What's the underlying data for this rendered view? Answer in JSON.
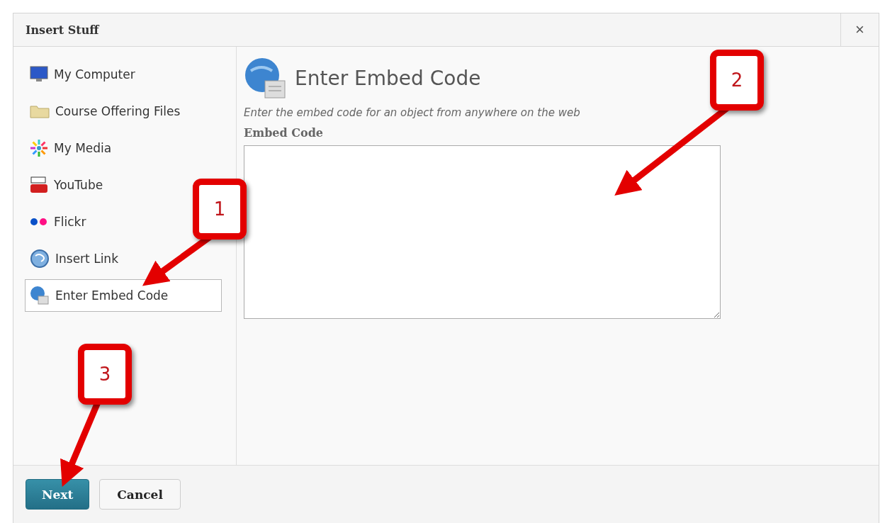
{
  "dialog": {
    "title": "Insert Stuff",
    "close": "×"
  },
  "sidebar": {
    "items": [
      {
        "label": "My Computer",
        "kind": "computer",
        "selected": false
      },
      {
        "label": "Course Offering Files",
        "kind": "folder",
        "selected": false
      },
      {
        "label": "My Media",
        "kind": "media",
        "selected": false
      },
      {
        "label": "YouTube",
        "kind": "youtube",
        "selected": false
      },
      {
        "label": "Flickr",
        "kind": "flickr",
        "selected": false
      },
      {
        "label": "Insert Link",
        "kind": "link",
        "selected": false
      },
      {
        "label": "Enter Embed Code",
        "kind": "embed",
        "selected": true
      }
    ]
  },
  "content": {
    "title": "Enter Embed Code",
    "description": "Enter the embed code for an object from anywhere on the web",
    "field_label": "Embed Code"
  },
  "footer": {
    "buttons": [
      {
        "label": "Next",
        "kind": "primary"
      },
      {
        "label": "Cancel",
        "kind": "secondary"
      }
    ]
  },
  "callouts": [
    {
      "number": "1"
    },
    {
      "number": "2"
    },
    {
      "number": "3"
    }
  ]
}
